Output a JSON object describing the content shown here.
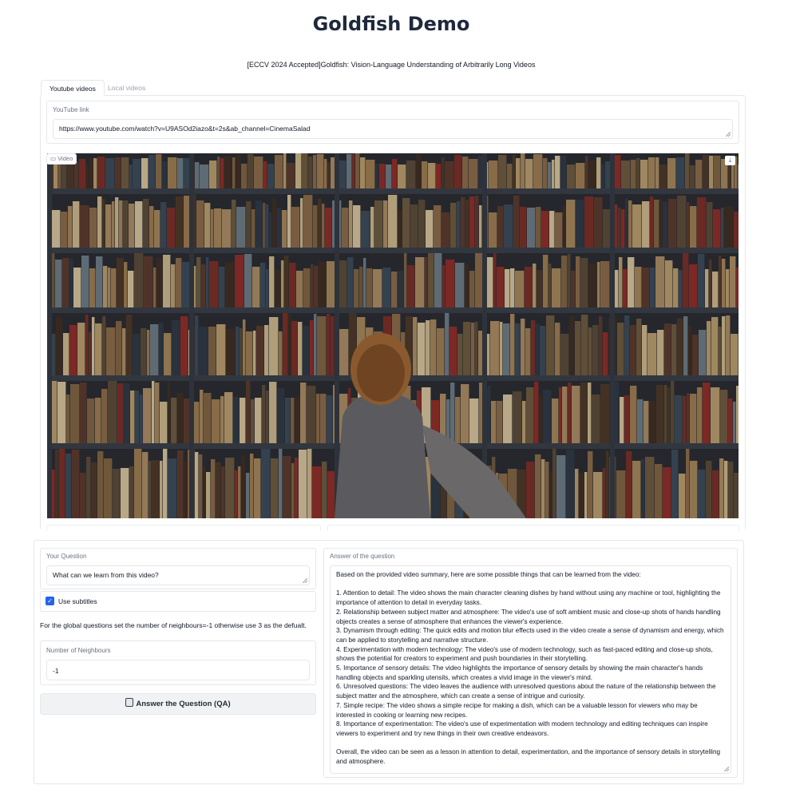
{
  "page": {
    "title": "Goldfish Demo",
    "subtitle": "[ECCV 2024 Accepted]Goldfish: Vision-Language Understanding of Arbitrarily Long Videos"
  },
  "tabs": [
    {
      "label": "Youtube videos",
      "active": true
    },
    {
      "label": "Local videos",
      "active": false
    }
  ],
  "youtube": {
    "label": "YouTube link",
    "value": "https://www.youtube.com/watch?v=U9ASOd2iazo&t=2s&ab_channel=CinemaSalad"
  },
  "video": {
    "badge_label": "Video",
    "badge_icon": "video-icon",
    "download_icon": "download-icon",
    "scene": "library-bookshelf-frame"
  },
  "question": {
    "label": "Your Question",
    "value": "What can we learn from this video?"
  },
  "subtitles": {
    "label": "Use subtitles",
    "checked": true
  },
  "neighbours_note": "For the global questions set the number of neighbours=-1 otherwise use 3 as the defualt.",
  "neighbours": {
    "label": "Number of Neighbours",
    "value": "-1"
  },
  "answer_button": {
    "icon": "robot-icon",
    "label": "Answer the Question (QA)"
  },
  "answer": {
    "label": "Answer of the question",
    "paragraphs": [
      "Based on the provided video summary, here are some possible things that can be learned from the video:",
      "",
      "1. Attention to detail: The video shows the main character cleaning dishes by hand without using any machine or tool, highlighting the importance of attention to detail in everyday tasks.",
      "2. Relationship between subject matter and atmosphere: The video's use of soft ambient music and close-up shots of hands handling objects creates a sense of atmosphere that enhances the viewer's experience.",
      "3. Dynamism through editing: The quick edits and motion blur effects used in the video create a sense of dynamism and energy, which can be applied to storytelling and narrative structure.",
      "4. Experimentation with modern technology: The video's use of modern technology, such as fast-paced editing and close-up shots, shows the potential for creators to experiment and push boundaries in their storytelling.",
      "5. Importance of sensory details: The video highlights the importance of sensory details by showing the main character's hands handling objects and sparkling utensils, which creates a vivid image in the viewer's mind.",
      "6. Unresolved questions: The video leaves the audience with unresolved questions about the nature of the relationship between the subject matter and the atmosphere, which can create a sense of intrigue and curiosity.",
      "7. Simple recipe: The video shows a simple recipe for making a dish, which can be a valuable lesson for viewers who may be interested in cooking or learning new recipes.",
      "8. Importance of experimentation: The video's use of experimentation with modern technology and editing techniques can inspire viewers to experiment and try new things in their own creative endeavors.",
      "",
      "Overall, the video can be seen as a lesson in attention to detail, experimentation, and the importance of sensory details in storytelling and atmosphere."
    ]
  },
  "colors": {
    "accent": "#2563eb",
    "title": "#1e293b",
    "border": "#e5e7eb",
    "button_bg": "#f1f2f4"
  }
}
